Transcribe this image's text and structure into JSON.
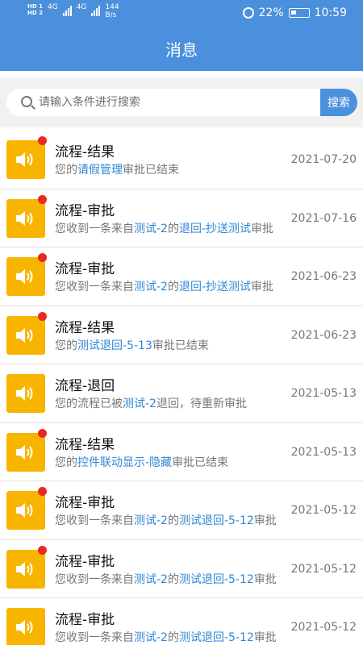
{
  "status_bar": {
    "sim1": "HD 1",
    "sim2": "HD 2",
    "net1": "4G",
    "net2": "4G",
    "speed_value": "144",
    "speed_unit": "B/s",
    "battery": "22%",
    "time": "10:59",
    "icons": [
      "alarm-icon",
      "battery-icon",
      "signal-icon"
    ]
  },
  "header": {
    "title": "消息"
  },
  "search": {
    "placeholder": "请输入条件进行搜索",
    "button": "搜索"
  },
  "colors": {
    "primary": "#4a90dc",
    "avatar": "#f7b500",
    "unread_dot": "#e8291f",
    "link": "#2f86d6"
  },
  "messages": [
    {
      "title": "流程-结果",
      "date": "2021-07-20",
      "unread": true,
      "desc": [
        {
          "t": "您的"
        },
        {
          "t": "请假管理",
          "hl": true
        },
        {
          "t": "审批已结束"
        }
      ]
    },
    {
      "title": "流程-审批",
      "date": "2021-07-16",
      "unread": true,
      "desc": [
        {
          "t": "您收到一条来自"
        },
        {
          "t": "测试-2",
          "hl": true
        },
        {
          "t": "的"
        },
        {
          "t": "退回-抄送测试",
          "hl": true
        },
        {
          "t": "审批"
        }
      ]
    },
    {
      "title": "流程-审批",
      "date": "2021-06-23",
      "unread": true,
      "desc": [
        {
          "t": "您收到一条来自"
        },
        {
          "t": "测试-2",
          "hl": true
        },
        {
          "t": "的"
        },
        {
          "t": "退回-抄送测试",
          "hl": true
        },
        {
          "t": "审批"
        }
      ]
    },
    {
      "title": "流程-结果",
      "date": "2021-06-23",
      "unread": true,
      "desc": [
        {
          "t": "您的"
        },
        {
          "t": "测试退回-5-13",
          "hl": true
        },
        {
          "t": "审批已结束"
        }
      ]
    },
    {
      "title": "流程-退回",
      "date": "2021-05-13",
      "unread": false,
      "desc": [
        {
          "t": "您的流程已被"
        },
        {
          "t": "测试-2",
          "hl": true
        },
        {
          "t": "退回，待重新审批"
        }
      ]
    },
    {
      "title": "流程-结果",
      "date": "2021-05-13",
      "unread": true,
      "desc": [
        {
          "t": "您的"
        },
        {
          "t": "控件联动显示-隐藏",
          "hl": true
        },
        {
          "t": "审批已结束"
        }
      ]
    },
    {
      "title": "流程-审批",
      "date": "2021-05-12",
      "unread": true,
      "desc": [
        {
          "t": "您收到一条来自"
        },
        {
          "t": "测试-2",
          "hl": true
        },
        {
          "t": "的"
        },
        {
          "t": "测试退回-5-12",
          "hl": true
        },
        {
          "t": "审批"
        }
      ]
    },
    {
      "title": "流程-审批",
      "date": "2021-05-12",
      "unread": true,
      "desc": [
        {
          "t": "您收到一条来自"
        },
        {
          "t": "测试-2",
          "hl": true
        },
        {
          "t": "的"
        },
        {
          "t": "测试退回-5-12",
          "hl": true
        },
        {
          "t": "审批"
        }
      ]
    },
    {
      "title": "流程-审批",
      "date": "2021-05-12",
      "unread": false,
      "desc": [
        {
          "t": "您收到一条来自"
        },
        {
          "t": "测试-2",
          "hl": true
        },
        {
          "t": "的"
        },
        {
          "t": "测试退回-5-12",
          "hl": true
        },
        {
          "t": "审批"
        }
      ]
    }
  ]
}
